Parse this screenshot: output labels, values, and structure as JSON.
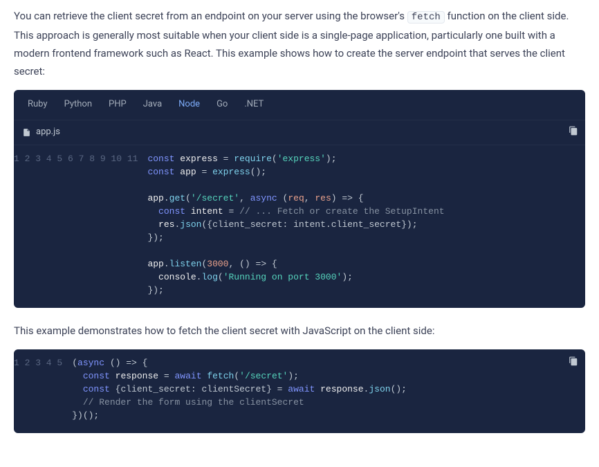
{
  "intro": {
    "before_fetch": "You can retrieve the client secret from an endpoint on your server using the browser's ",
    "fetch_code": "fetch",
    "after_fetch": " function on the client side. This approach is generally most suitable when your client side is a single-page application, particularly one built with a modern frontend framework such as React. This example shows how to create the server endpoint that serves the client secret:"
  },
  "code1": {
    "tabs": {
      "ruby": "Ruby",
      "python": "Python",
      "php": "PHP",
      "java": "Java",
      "node": "Node",
      "go": "Go",
      "dotnet": ".NET"
    },
    "active_tab": "node",
    "filename": "app.js",
    "line_count": 11,
    "tokens": {
      "const": "const",
      "express_id": "express",
      "eq": " = ",
      "require": "require",
      "lp": "(",
      "rp": ")",
      "sc": ";",
      "express_str": "'express'",
      "app_id": "app",
      "express_call": "express",
      "empty_parens": "()",
      "dot": ".",
      "get": "get",
      "secret_str": "'/secret'",
      "comma_sp": ", ",
      "async": "async",
      "req": "req",
      "res": "res",
      "arrow": " => {",
      "sp2": "  ",
      "intent_id": "intent",
      "fetch_comment": "// ... Fetch or create the SetupIntent",
      "json": "json",
      "json_args": "({client_secret: intent.client_secret})",
      "close_brace": "});",
      "listen": "listen",
      "port": "3000",
      "noargs_arrow": " () => {",
      "console": "console",
      "log": "log",
      "running_str": "'Running on port 3000'"
    }
  },
  "mid_text": "This example demonstrates how to fetch the client secret with JavaScript on the client side:",
  "code2": {
    "line_count": 5,
    "tokens": {
      "lp": "(",
      "async": "async",
      "noargs_arrow": " () => {",
      "sp2": "  ",
      "const": "const",
      "response": "response",
      "eq": " = ",
      "await": "await",
      "sp": " ",
      "fetch": "fetch",
      "secret_str": "'/secret'",
      "rp_sc": ");",
      "destruct": " {client_secret: clientSecret} = ",
      "dot": ".",
      "json": "json",
      "empty_parens_sc": "();",
      "render_comment": "// Render the form using the clientSecret",
      "iife_close": "})();"
    }
  }
}
